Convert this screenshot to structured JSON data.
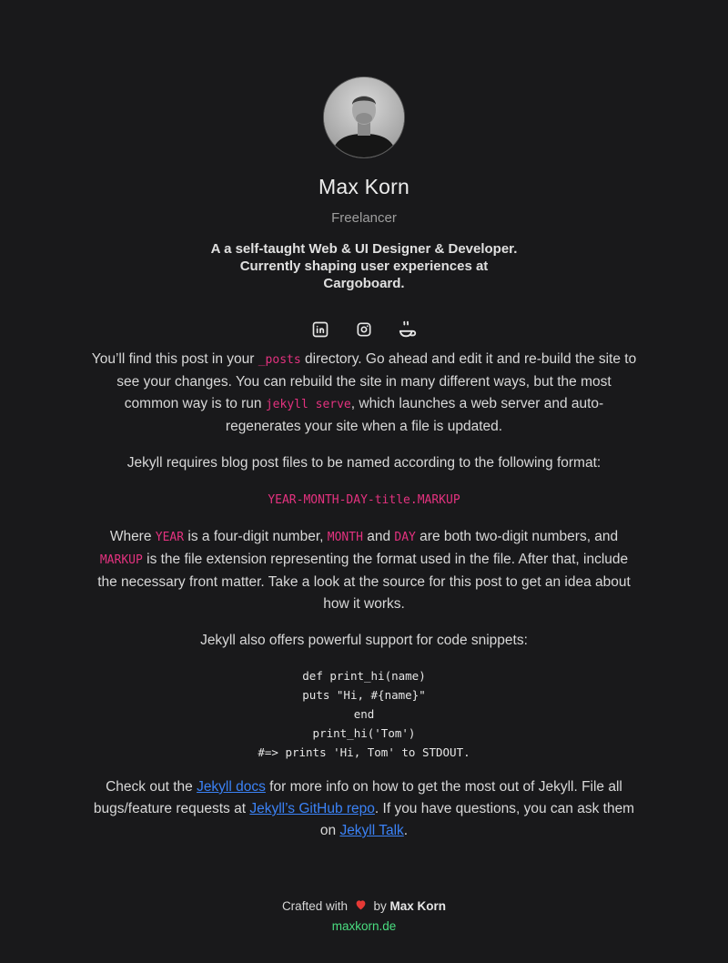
{
  "profile": {
    "name": "Max Korn",
    "role": "Freelancer",
    "bio_line1": "A a self-taught Web & UI Designer & Developer.",
    "bio_line2": "Currently shaping user experiences at",
    "bio_line3": "Cargoboard."
  },
  "socials": {
    "items": [
      "linkedin-icon",
      "instagram-icon",
      "coffee-icon"
    ]
  },
  "post": {
    "p1_a": "You’ll find this post in your ",
    "p1_code": "_posts",
    "p1_b": " directory. Go ahead and edit it and re-build the site to see your changes. You can rebuild the site in many different ways, but the most common way is to run ",
    "p1_code2": "jekyll serve",
    "p1_c": ", which launches a web server and auto-regenerates your site when a file is updated.",
    "p2": "Jekyll requires blog post files to be named according to the following format:",
    "format_code": "YEAR-MONTH-DAY-title.MARKUP",
    "p3_a": "Where ",
    "p3_year": "YEAR",
    "p3_b": " is a four-digit number, ",
    "p3_month": "MONTH",
    "p3_c": " and ",
    "p3_day": "DAY",
    "p3_d": " are both two-digit numbers, and ",
    "p3_markup": "MARKUP",
    "p3_e": " is the file extension representing the format used in the file. After that, include the necessary front matter. Take a look at the source for this post to get an idea about how it works.",
    "p4": "Jekyll also offers powerful support for code snippets:",
    "code_lines": [
      "def print_hi(name)",
      "puts \"Hi, #{name}\"",
      "end",
      "print_hi('Tom')",
      "#=> prints 'Hi, Tom' to STDOUT."
    ],
    "p5_a": "Check out the ",
    "p5_link1": "Jekyll docs",
    "p5_b": " for more info on how to get the most out of Jekyll. File all bugs/feature requests at ",
    "p5_link2": "Jekyll’s GitHub repo",
    "p5_c": ". If you have questions, you can ask them on ",
    "p5_link3": "Jekyll Talk",
    "p5_d": "."
  },
  "footer": {
    "crafted": "Crafted with",
    "by": "by",
    "author": "Max Korn",
    "site": "maxkorn.de"
  },
  "colors": {
    "background": "#19191b",
    "inline_code": "#e3327f",
    "link": "#3b82f6",
    "site_link": "#4ade80",
    "heart": "#e53935"
  }
}
